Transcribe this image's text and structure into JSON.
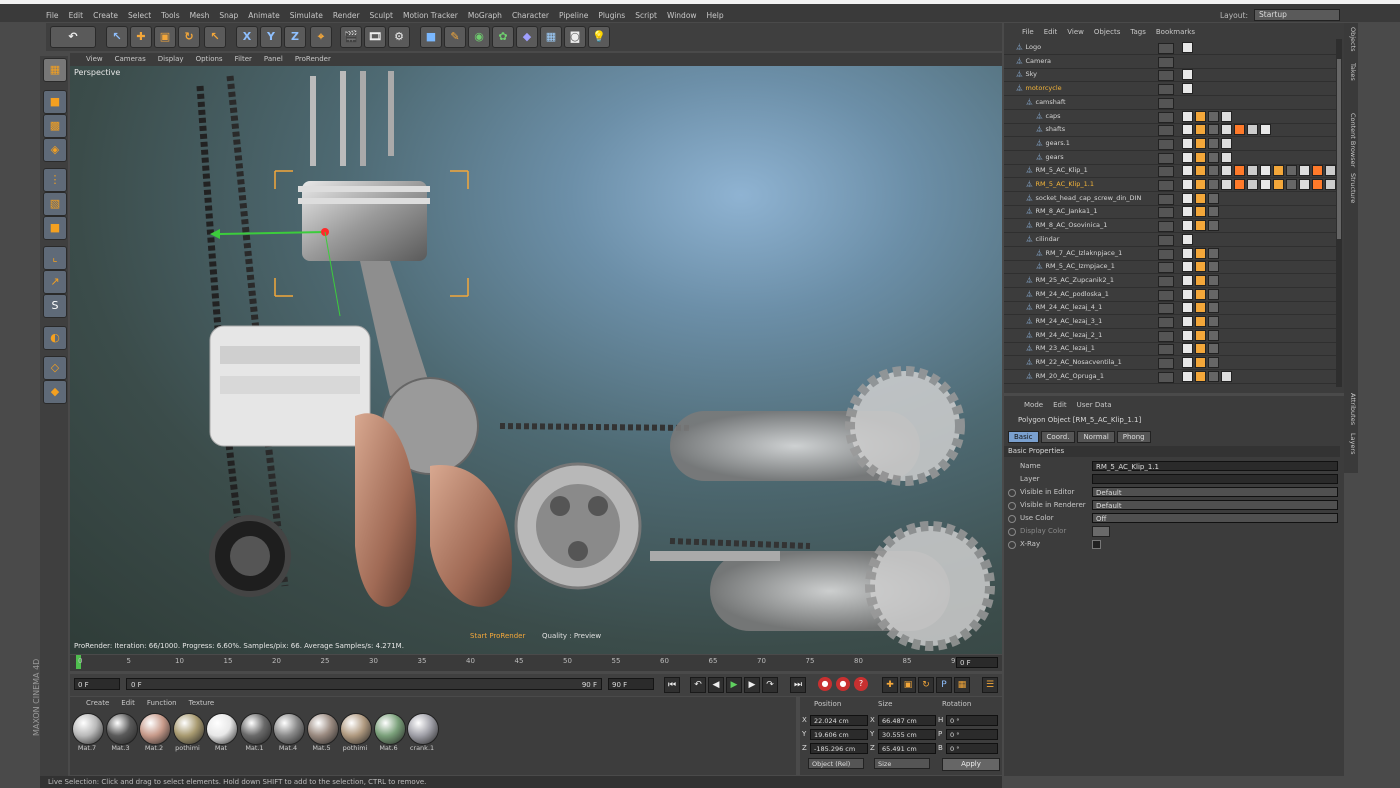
{
  "menubar": {
    "items": [
      "File",
      "Edit",
      "Create",
      "Select",
      "Tools",
      "Mesh",
      "Snap",
      "Animate",
      "Simulate",
      "Render",
      "Sculpt",
      "Motion Tracker",
      "MoGraph",
      "Character",
      "Pipeline",
      "Plugins",
      "Script",
      "Window",
      "Help"
    ],
    "layout_label": "Layout:",
    "layout_value": "Startup"
  },
  "toolbar": {
    "undo_icon": "undo-icon",
    "axis_labels": [
      "X",
      "Y",
      "Z"
    ]
  },
  "viewport": {
    "menu": [
      "View",
      "Cameras",
      "Display",
      "Options",
      "Filter",
      "Panel",
      "ProRender"
    ],
    "camera_label": "Perspective",
    "status": "ProRender: Iteration: 66/1000. Progress: 6.60%. Samples/pix: 66. Average Samples/s: 4.271M.",
    "start_prorender": "Start ProRender",
    "quality": "Quality : Preview"
  },
  "timeline": {
    "ticks": [
      "0",
      "5",
      "10",
      "15",
      "20",
      "25",
      "30",
      "35",
      "40",
      "45",
      "50",
      "55",
      "60",
      "65",
      "70",
      "75",
      "80",
      "85",
      "90"
    ],
    "current_frame": "0 F"
  },
  "transport": {
    "start_field": "0 F",
    "range_start": "0 F",
    "range_end": "90 F",
    "end_field": "90 F"
  },
  "materials": {
    "menu": [
      "Create",
      "Edit",
      "Function",
      "Texture"
    ],
    "items": [
      {
        "label": "Mat.7",
        "color": "#b9b9b9"
      },
      {
        "label": "Mat.3",
        "color": "#5a5a5a"
      },
      {
        "label": "Mat.2",
        "color": "#c79a8a"
      },
      {
        "label": "pothimi",
        "color": "#a89a70"
      },
      {
        "label": "Mat",
        "color": "#e8e8e8"
      },
      {
        "label": "Mat.1",
        "color": "#6a6a6a"
      },
      {
        "label": "Mat.4",
        "color": "#8a8a8a"
      },
      {
        "label": "Mat.5",
        "color": "#9a8a80"
      },
      {
        "label": "pothimi",
        "color": "#b09a80"
      },
      {
        "label": "Mat.6",
        "color": "#7aa07a"
      },
      {
        "label": "crank.1",
        "color": "#a0a0a8"
      }
    ]
  },
  "coordinates": {
    "headers": [
      "Position",
      "Size",
      "Rotation"
    ],
    "rows": [
      {
        "axis": "X",
        "pos": "22.024 cm",
        "size_axis": "X",
        "size": "66.487 cm",
        "rot_axis": "H",
        "rot": "0 °"
      },
      {
        "axis": "Y",
        "pos": "19.606 cm",
        "size_axis": "Y",
        "size": "30.555 cm",
        "rot_axis": "P",
        "rot": "0 °"
      },
      {
        "axis": "Z",
        "pos": "-185.296 cm",
        "size_axis": "Z",
        "size": "65.491 cm",
        "rot_axis": "B",
        "rot": "0 °"
      }
    ],
    "mode_dropdown": "Object (Rel)",
    "size_dropdown": "Size",
    "apply": "Apply"
  },
  "statusbar": "Live Selection: Click and drag to select elements. Hold down SHIFT to add to the selection, CTRL to remove.",
  "logo": "MAXON CINEMA 4D",
  "object_manager": {
    "menu": [
      "File",
      "Edit",
      "View",
      "Objects",
      "Tags",
      "Bookmarks"
    ],
    "rows": [
      {
        "name": "Logo",
        "indent": 0,
        "highlight": false,
        "tags": 1
      },
      {
        "name": "Camera",
        "indent": 0,
        "highlight": false,
        "tags": 0
      },
      {
        "name": "Sky",
        "indent": 0,
        "highlight": false,
        "tags": 1
      },
      {
        "name": "motorcycle",
        "indent": 0,
        "highlight": true,
        "tags": 1
      },
      {
        "name": "camshaft",
        "indent": 1,
        "highlight": false,
        "tags": 0
      },
      {
        "name": "caps",
        "indent": 2,
        "highlight": false,
        "tags": 4
      },
      {
        "name": "shafts",
        "indent": 2,
        "highlight": false,
        "tags": 7
      },
      {
        "name": "gears.1",
        "indent": 2,
        "highlight": false,
        "tags": 4
      },
      {
        "name": "gears",
        "indent": 2,
        "highlight": false,
        "tags": 4
      },
      {
        "name": "RM_5_AC_Klip_1",
        "indent": 1,
        "highlight": false,
        "tags": 12
      },
      {
        "name": "RM_5_AC_Klip_1.1",
        "indent": 1,
        "highlight": true,
        "tags": 12
      },
      {
        "name": "socket_head_cap_screw_din_DIN",
        "indent": 1,
        "highlight": false,
        "tags": 3
      },
      {
        "name": "RM_8_AC_Janka1_1",
        "indent": 1,
        "highlight": false,
        "tags": 3
      },
      {
        "name": "RM_8_AC_Osovinica_1",
        "indent": 1,
        "highlight": false,
        "tags": 3
      },
      {
        "name": "cilindar",
        "indent": 1,
        "highlight": false,
        "tags": 1
      },
      {
        "name": "RM_7_AC_Izlaknpjace_1",
        "indent": 2,
        "highlight": false,
        "tags": 3
      },
      {
        "name": "RM_5_AC_Izmpjace_1",
        "indent": 2,
        "highlight": false,
        "tags": 3
      },
      {
        "name": "RM_25_AC_Zupcanik2_1",
        "indent": 1,
        "highlight": false,
        "tags": 3
      },
      {
        "name": "RM_24_AC_podloska_1",
        "indent": 1,
        "highlight": false,
        "tags": 3
      },
      {
        "name": "RM_24_AC_lezaj_4_1",
        "indent": 1,
        "highlight": false,
        "tags": 3
      },
      {
        "name": "RM_24_AC_lezaj_3_1",
        "indent": 1,
        "highlight": false,
        "tags": 3
      },
      {
        "name": "RM_24_AC_lezaj_2_1",
        "indent": 1,
        "highlight": false,
        "tags": 3
      },
      {
        "name": "RM_23_AC_lezaj_1",
        "indent": 1,
        "highlight": false,
        "tags": 3
      },
      {
        "name": "RM_22_AC_Nosacventila_1",
        "indent": 1,
        "highlight": false,
        "tags": 3
      },
      {
        "name": "RM_20_AC_Opruga_1",
        "indent": 1,
        "highlight": false,
        "tags": 4
      }
    ]
  },
  "attribute_manager": {
    "menu": [
      "Mode",
      "Edit",
      "User Data"
    ],
    "title": "Polygon Object [RM_5_AC_Klip_1.1]",
    "tabs": [
      "Basic",
      "Coord.",
      "Normal",
      "Phong"
    ],
    "section": "Basic Properties",
    "fields": [
      {
        "label": "Name",
        "value": "RM_5_AC_Klip_1.1",
        "type": "text",
        "dim": false
      },
      {
        "label": "Layer",
        "value": "",
        "type": "text",
        "dim": false
      },
      {
        "label": "Visible in Editor",
        "value": "Default",
        "type": "dropdown",
        "dim": false
      },
      {
        "label": "Visible in Renderer",
        "value": "Default",
        "type": "dropdown",
        "dim": false
      },
      {
        "label": "Use Color",
        "value": "Off",
        "type": "dropdown",
        "dim": false
      },
      {
        "label": "Display Color",
        "value": "",
        "type": "color",
        "dim": true
      },
      {
        "label": "X-Ray",
        "value": "",
        "type": "check",
        "dim": false
      }
    ]
  },
  "right_tabs": [
    "Objects",
    "Takes",
    "Content Browser",
    "Structure",
    "Attributes",
    "Layers"
  ],
  "colors": {
    "accent_orange": "#f3a73a",
    "selected_blue": "#7aa0cf",
    "panel": "#3c3c3c"
  }
}
